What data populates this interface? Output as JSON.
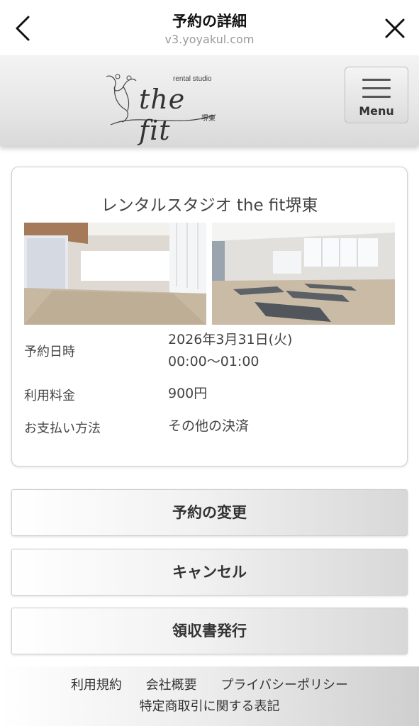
{
  "topbar": {
    "title": "予約の詳細",
    "url": "v3.yoyakul.com",
    "back_icon": "chevron-left-icon",
    "close_icon": "close-icon"
  },
  "header": {
    "logo_small": "rental studio",
    "logo_main": "the fit",
    "logo_sub": "堺東",
    "menu_label": "Menu",
    "menu_icon": "hamburger-icon"
  },
  "reservation": {
    "studio_name": "レンタルスタジオ the fit堺東",
    "photos": [
      "studio-photo-1",
      "studio-photo-2"
    ],
    "datetime_label": "予約日時",
    "date": "2026年3月31日(火)",
    "time": "00:00〜01:00",
    "fee_label": "利用料金",
    "fee": "900円",
    "payment_label": "お支払い方法",
    "payment": "その他の決済"
  },
  "actions": {
    "change": "予約の変更",
    "cancel": "キャンセル",
    "receipt": "領収書発行"
  },
  "footer": {
    "terms": "利用規約",
    "company": "会社概要",
    "privacy": "プライバシーポリシー",
    "commerce": "特定商取引に関する表記"
  },
  "colors": {
    "header_gradient_start": "#f3f3f3",
    "header_gradient_end": "#d9d9d9",
    "text": "#333333",
    "url_gray": "#9a9a9a"
  }
}
